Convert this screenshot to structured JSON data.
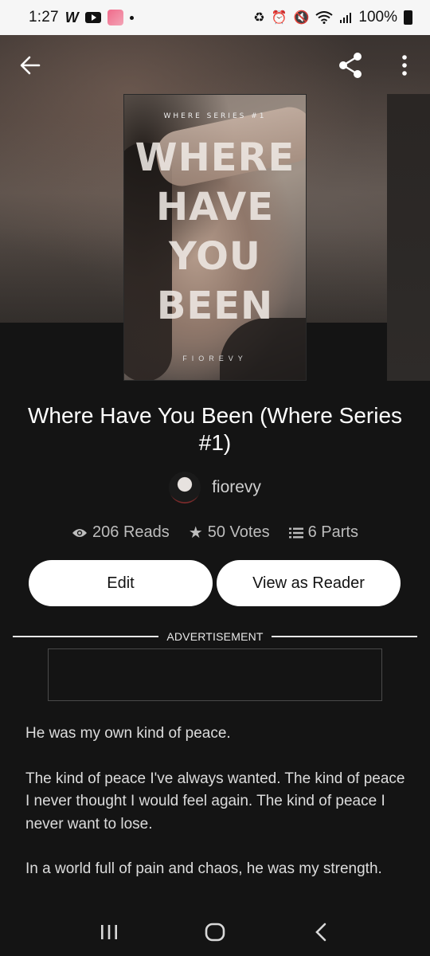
{
  "status_bar": {
    "time": "1:27",
    "battery": "100%",
    "icons": [
      "wattpad-w-icon",
      "youtube-icon",
      "app-icon",
      "dot-icon",
      "battery-saver-icon",
      "alarm-icon",
      "mute-icon",
      "wifi-icon",
      "signal-icon",
      "battery-icon"
    ]
  },
  "header": {
    "back_icon": "arrow-left-icon",
    "share_icon": "share-icon",
    "more_icon": "more-vertical-icon"
  },
  "cover": {
    "series_text": "WHERE SERIES #1",
    "title_lines": [
      "WHERE",
      "HAVE",
      "YOU",
      "BEEN"
    ],
    "author_text": "FIOREVY"
  },
  "story": {
    "title": "Where Have You Been (Where Series #1)",
    "author": "fiorevy",
    "reads": "206 Reads",
    "votes": "50 Votes",
    "parts": "6 Parts"
  },
  "actions": {
    "edit_label": "Edit",
    "view_label": "View as Reader"
  },
  "ad": {
    "label": "ADVERTISEMENT"
  },
  "description": {
    "p1": "He was my own kind of peace.",
    "p2": "The kind of peace I've always wanted. The kind of peace I never thought I would feel again. The kind of peace I never want to lose.",
    "p3": "In a world full of pain and chaos, he was my strength."
  },
  "colors": {
    "background": "#141414",
    "button_bg": "#ffffff",
    "text_secondary": "#bdbdbd"
  }
}
